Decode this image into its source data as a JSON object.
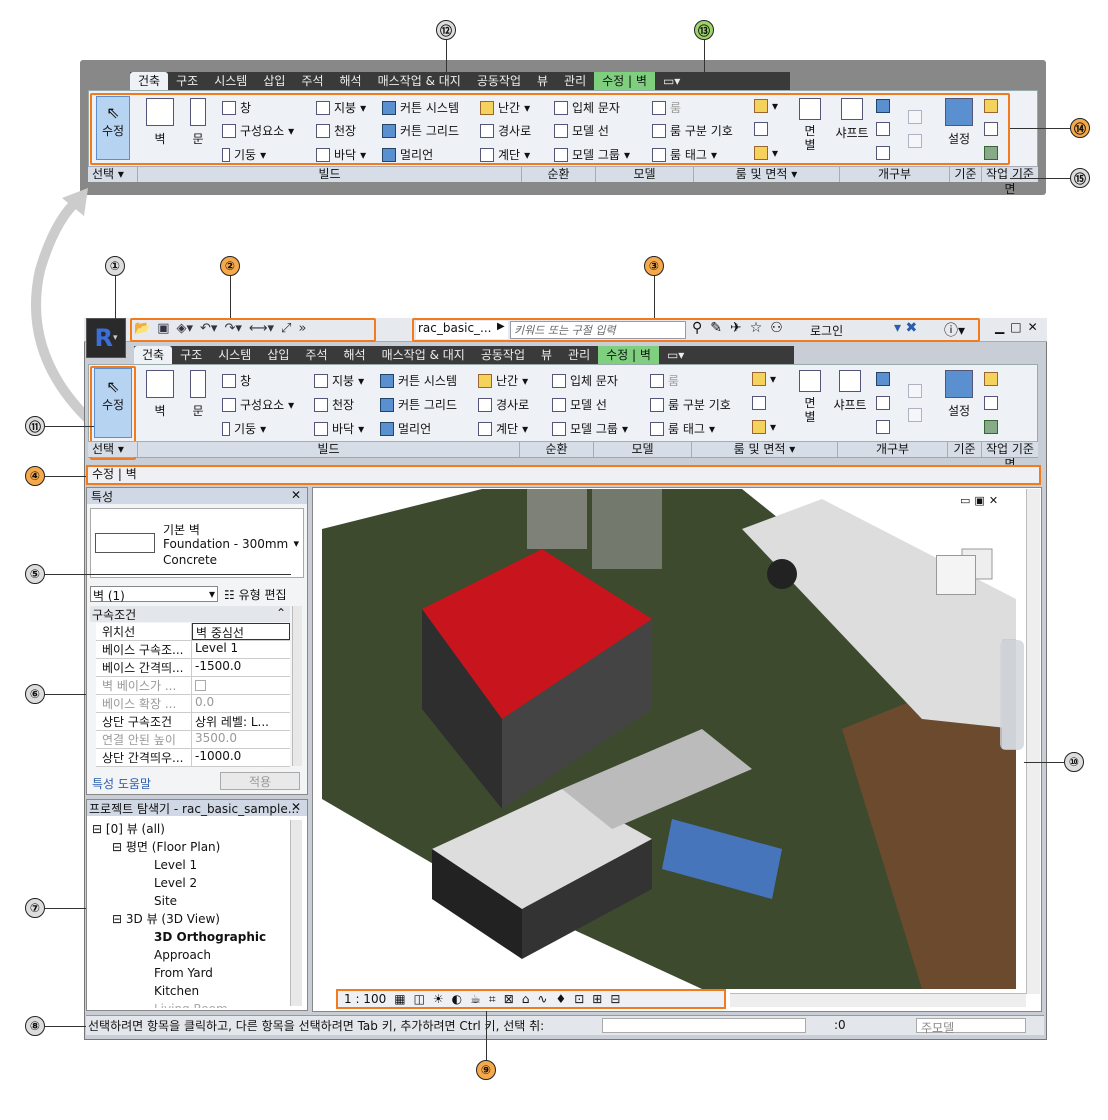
{
  "callouts": [
    "①",
    "②",
    "③",
    "④",
    "⑤",
    "⑥",
    "⑦",
    "⑧",
    "⑨",
    "⑩",
    "⑪",
    "⑫",
    "⑬",
    "⑭",
    "⑮"
  ],
  "ribbon": {
    "tabs": [
      "건축",
      "구조",
      "시스템",
      "삽입",
      "주석",
      "해석",
      "매스작업 & 대지",
      "공동작업",
      "뷰",
      "관리"
    ],
    "context_tab": "수정 | 벽",
    "modify_label": "수정",
    "select_label": "선택 ▾",
    "panels": [
      "빌드",
      "순환",
      "모델",
      "룸 및 면적 ▾",
      "개구부",
      "기준",
      "작업 기준면"
    ],
    "build": {
      "wall": "벽",
      "door": "문",
      "window": "창",
      "component": "구성요소",
      "column": "기둥",
      "roof": "지붕",
      "ceiling": "천장",
      "floor": "바닥",
      "curtain_system": "커튼 시스템",
      "curtain_grid": "커튼 그리드",
      "mullion": "멀리언"
    },
    "circulation": {
      "railing": "난간",
      "ramp": "경사로",
      "stair": "계단"
    },
    "model": {
      "text": "입체 문자",
      "line": "모델 선",
      "group": "모델 그룹"
    },
    "room": {
      "room": "룸",
      "separator": "룸 구분 기호",
      "tag": "룸 태그"
    },
    "opening": {
      "face": "면\n별",
      "shaft": "샤프트"
    },
    "workplane": {
      "set": "설정"
    }
  },
  "qat": {
    "file_name": "rac_basic_...",
    "search_placeholder": "키워드 또는 구절 입력",
    "login": "로그인"
  },
  "options_bar": "수정 | 벽",
  "properties": {
    "title": "특성",
    "type_line1": "기본 벽",
    "type_line2": "Foundation - 300mm",
    "type_line3": "Concrete",
    "selector": "벽 (1)",
    "edit_type": "유형 편집",
    "section": "구속조건",
    "rows": [
      {
        "k": "위치선",
        "v": "벽 중심선"
      },
      {
        "k": "베이스 구속조...",
        "v": "Level 1"
      },
      {
        "k": "베이스 간격띄...",
        "v": "-1500.0"
      },
      {
        "k": "벽 베이스가 ...",
        "v": ""
      },
      {
        "k": "베이스 확장 ...",
        "v": "0.0"
      },
      {
        "k": "상단 구속조건",
        "v": "상위 레벨: L..."
      },
      {
        "k": "연결 안된 높이",
        "v": "3500.0"
      },
      {
        "k": "상단 간격띄우...",
        "v": "-1000.0"
      }
    ],
    "help": "특성 도움말",
    "apply": "적용"
  },
  "browser": {
    "title": "프로젝트 탐색기 - rac_basic_sample...",
    "items": [
      {
        "t": "[0] 뷰 (all)",
        "lvl": 0,
        "bold": false
      },
      {
        "t": "평면 (Floor Plan)",
        "lvl": 1,
        "bold": false
      },
      {
        "t": "Level 1",
        "lvl": 2,
        "bold": false
      },
      {
        "t": "Level 2",
        "lvl": 2,
        "bold": false
      },
      {
        "t": "Site",
        "lvl": 2,
        "bold": false
      },
      {
        "t": "3D 뷰 (3D View)",
        "lvl": 1,
        "bold": false
      },
      {
        "t": "3D Orthographic",
        "lvl": 2,
        "bold": true
      },
      {
        "t": "Approach",
        "lvl": 2,
        "bold": false
      },
      {
        "t": "From Yard",
        "lvl": 2,
        "bold": false
      },
      {
        "t": "Kitchen",
        "lvl": 2,
        "bold": false
      },
      {
        "t": "Living Room",
        "lvl": 2,
        "bold": false
      }
    ]
  },
  "view": {
    "scale": "1 : 100"
  },
  "status": {
    "text": "선택하려면 항목을 클릭하고, 다른 항목을 선택하려면 Tab 키, 추가하려면 Ctrl 키, 선택 취:",
    "count": ":0",
    "model": "주모델"
  },
  "colors": {
    "accent": "#f07c1f",
    "roof": "#c8141c",
    "terrain": "#3d4a2e"
  }
}
